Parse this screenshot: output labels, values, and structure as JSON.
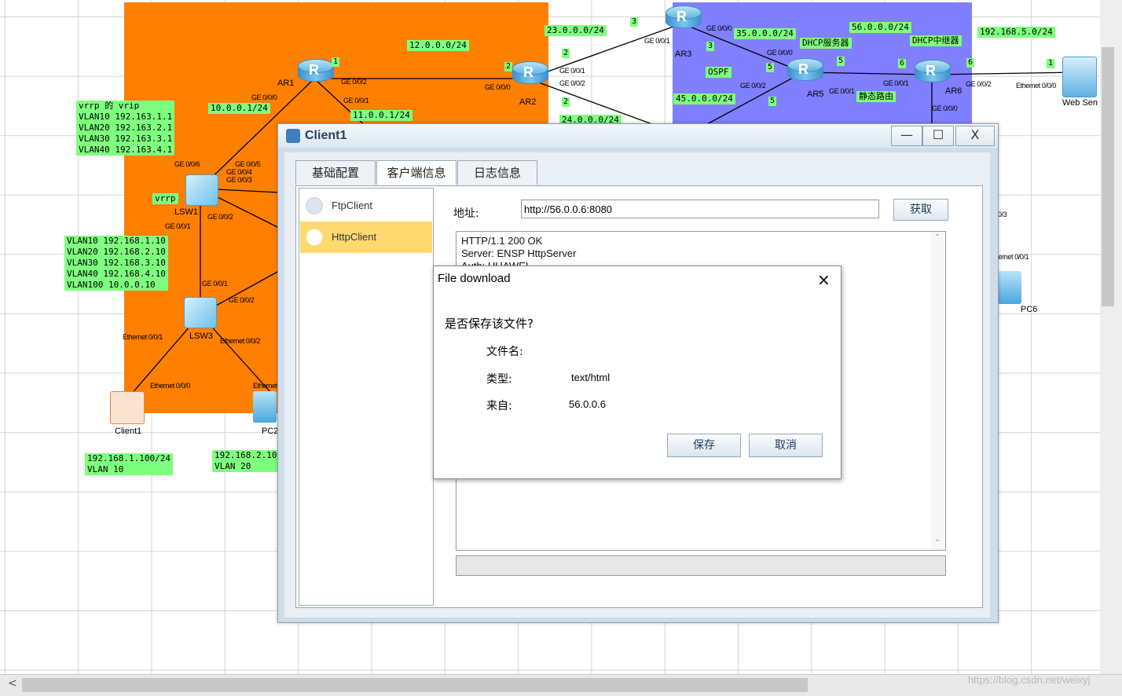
{
  "topology": {
    "devices": {
      "ar1": "AR1",
      "ar2": "AR2",
      "ar3": "AR3",
      "ar5": "AR5",
      "ar6": "AR6",
      "lsw1": "LSW1",
      "lsw3": "LSW3",
      "client1": "Client1",
      "pc2": "PC2",
      "pc6": "PC6",
      "web": "Web Sen"
    },
    "labels": {
      "net12": "12.0.0.0/24",
      "net23": "23.0.0.0/24",
      "net35": "35.0.0.0/24",
      "net56": "56.0.0.0/24",
      "net1925": "192.168.5.0/24",
      "net10": "10.0.0.1/24",
      "net11": "11.0.0.1/24",
      "net45": "45.0.0.0/24",
      "net24": "24.0.0.0/24",
      "ospf": "OSPF",
      "dhcp_server": "DHCP服务器",
      "dhcp_relay": "DHCP中继器",
      "static_route": "静态路由",
      "vrrp": "vrrp",
      "vrip": "vrrp 的 vrip\nVLAN10 192.163.1.1\nVLAN20 192.163.2.1\nVLAN30 192.163.3.1\nVLAN40 192.163.4.1",
      "vlans": "VLAN10 192.168.1.10\nVLAN20 192.168.2.10\nVLAN30 192.168.3.10\nVLAN40 192.168.4.10\nVLAN100 10.0.0.10",
      "client_ip": "192.168.1.100/24\nVLAN 10",
      "pc2_ip": "192.168.2.10\nVLAN 20"
    },
    "ports": {
      "p1": "GE 0/0/0",
      "p2": "GE 0/0/2",
      "p3": "GE 0/0/1",
      "p4": "GE 0/0/6",
      "p5": "GE 0/0/5",
      "p6": "GE 0/0/4",
      "p7": "GE 0/0/3",
      "p8": "GE 0/0/2",
      "p9": "GE 0/0/1",
      "p10": "GE 0/0/1",
      "p11": "GE 0/0/2",
      "p12": "Ethernet 0/0/1",
      "p13": "Ethernet 0/0/2",
      "p14": "Ethernet 0/0/0",
      "p15": "Ethernet",
      "p16": "GE 0/0/0",
      "p17": "GE 0/0/1",
      "p18": "GE 0/0/2",
      "p19": "GE 0/0/1",
      "p20": "GE 0/0/0",
      "p21": "GE 0/0/0",
      "p22": "GE 0/0/2",
      "p23": "GE 0/0/1",
      "p24": "GE 0/0/1",
      "p25": "GE 0/0/2",
      "p26": "GE 0/0/0",
      "p27": "Ethernet 0/0/0",
      "p28": "0/3",
      "p29": "hernet 0/0/1"
    },
    "nums": {
      "n1": "1",
      "n2": "2",
      "n3": "3",
      "n4": "2",
      "n5": "2",
      "n6": "3",
      "n7": "5",
      "n8": "5",
      "n9": "5",
      "n10": "6",
      "n11": "6",
      "n12": "1"
    }
  },
  "window": {
    "title": "Client1",
    "min_label": "—",
    "max_label": "☐",
    "close_label": "X",
    "tabs": [
      "基础配置",
      "客户端信息",
      "日志信息"
    ],
    "nav": [
      "FtpClient",
      "HttpClient"
    ],
    "address_label": "地址:",
    "address_value": "http://56.0.0.6:8080",
    "fetch_label": "获取",
    "response_lines": [
      "HTTP/1.1 200 OK",
      "Server: ENSP HttpServer",
      "Auth: HUAWEI"
    ]
  },
  "dialog": {
    "title": "File download",
    "close": "×",
    "question": "是否保存该文件?",
    "filename_label": "文件名:",
    "filename_value": "",
    "type_label": "类型:",
    "type_value": "text/html",
    "from_label": "来自:",
    "from_value": "56.0.0.6",
    "save_label": "保存",
    "cancel_label": "取消"
  },
  "watermark": "https://blog.csdn.net/weixyj"
}
